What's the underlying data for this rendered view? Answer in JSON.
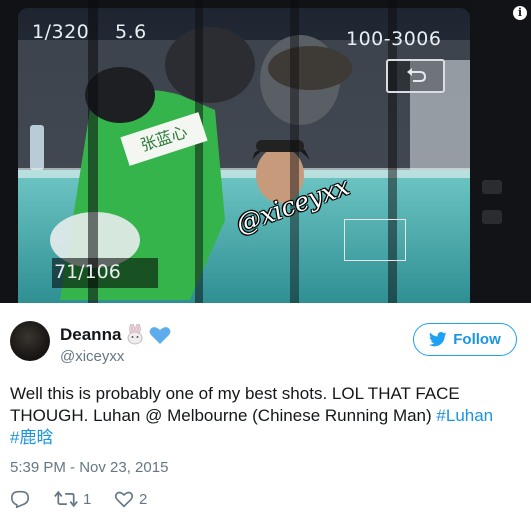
{
  "photo": {
    "shutter_speed": "1/320",
    "aperture": "5.6",
    "folder_file": "100-3006",
    "frame_count": "71/106",
    "nametag_text": "张蓝心",
    "watermark": "@xiceyxx",
    "info_icon_label": "i",
    "back_icon": "return-arrow-icon"
  },
  "tweet": {
    "display_name": "Deanna",
    "name_emojis": [
      "rabbit-emoji",
      "blue-heart-emoji"
    ],
    "handle": "@xiceyxx",
    "follow_label": "Follow",
    "text_plain": "Well this is probably one of my best shots. LOL THAT FACE THOUGH. Luhan @ Melbourne (Chinese Running Man) ",
    "hashtag1": "#Luhan",
    "hashtag2": "#鹿晗",
    "timestamp": "5:39 PM - Nov 23, 2015",
    "retweet_count": "1",
    "like_count": "2"
  },
  "colors": {
    "link_blue": "#1b95e0",
    "follow_border": "#1da1f2",
    "secondary_text": "#657786",
    "primary_text": "#14171a"
  }
}
